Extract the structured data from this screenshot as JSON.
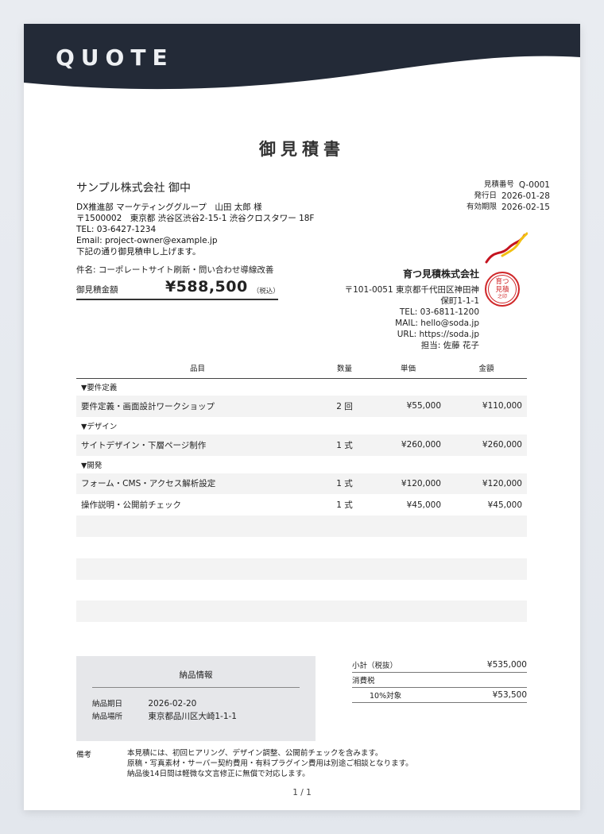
{
  "banner": {
    "label": "QUOTE",
    "color": "#232a37"
  },
  "document": {
    "title": "御見積書"
  },
  "client": {
    "name": "サンプル株式会社 御中",
    "contact": "DX推進部 マーケティンググループ　山田 太郎 様",
    "address": "〒1500002　東京都 渋谷区渋谷2-15-1 渋谷クロスタワー 18F",
    "tel": "TEL: 03-6427-1234",
    "email": "Email: project-owner@example.jp",
    "greeting": "下記の通り御見積申し上げます。"
  },
  "meta": {
    "number_label": "見積番号",
    "number": "Q-0001",
    "issued_label": "発行日",
    "issued": "2026-01-28",
    "valid_label": "有効期限",
    "valid": "2026-02-15"
  },
  "subject": "件名: コーポレートサイト刷新・問い合わせ導線改善",
  "total": {
    "label": "御見積金額",
    "value": "¥588,500",
    "tax_note": "（税込）"
  },
  "issuer": {
    "name": "育つ見積株式会社",
    "address1": "〒101-0051 東京都千代田区神田神",
    "address2": "保町1-1-1",
    "tel": "TEL: 03-6811-1200",
    "mail": "MAIL: hello@soda.jp",
    "url": "URL: https://soda.jp",
    "staff": "担当: 佐藤 花子",
    "seal_line1": "育つ",
    "seal_line2": "見積",
    "seal_line3": "之印"
  },
  "table": {
    "headers": {
      "item": "品目",
      "qty": "数量",
      "unit": "単価",
      "amount": "金額"
    },
    "rows": [
      {
        "category": "▼要件定義"
      },
      {
        "item": "要件定義・画面設計ワークショップ",
        "qty": "2 回",
        "unit": "¥55,000",
        "amount": "¥110,000"
      },
      {
        "category": "▼デザイン"
      },
      {
        "item": "サイトデザイン・下層ページ制作",
        "qty": "1 式",
        "unit": "¥260,000",
        "amount": "¥260,000"
      },
      {
        "category": "▼開発"
      },
      {
        "item": "フォーム・CMS・アクセス解析設定",
        "qty": "1 式",
        "unit": "¥120,000",
        "amount": "¥120,000"
      },
      {
        "item": "操作説明・公開前チェック",
        "qty": "1 式",
        "unit": "¥45,000",
        "amount": "¥45,000"
      }
    ]
  },
  "delivery": {
    "title": "納品情報",
    "date_label": "納品期日",
    "date": "2026-02-20",
    "place_label": "納品場所",
    "place": "東京都品川区大崎1-1-1"
  },
  "summary": {
    "subtotal_label": "小計（税抜）",
    "subtotal": "¥535,000",
    "tax_label": "消費税",
    "rate_label": "10%対象",
    "rate_amount": "¥53,500"
  },
  "notes": {
    "label": "備考",
    "lines": [
      "本見積には、初回ヒアリング、デザイン調整、公開前チェックを含みます。",
      "原稿・写真素材・サーバー契約費用・有料プラグイン費用は別途ご相談となります。",
      "納品後14日間は軽微な文言修正に無償で対応します。"
    ]
  },
  "pager": "1 / 1"
}
